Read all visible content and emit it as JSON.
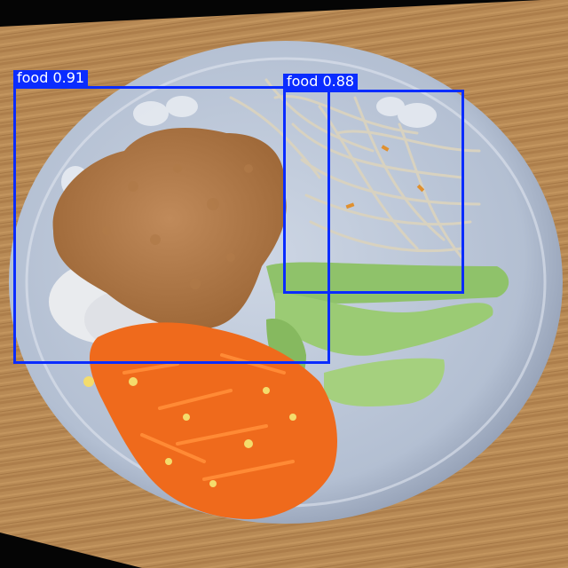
{
  "image": {
    "description": "Top-down photo of a plate with fried cutlet, rice, bean sprouts, green vegetables and shredded carrot-egg stir fry"
  },
  "colors": {
    "box": "#0a2cff",
    "label_text": "#ffffff"
  },
  "detections": [
    {
      "label": "food 0.91"
    },
    {
      "label": "food 0.88"
    }
  ]
}
